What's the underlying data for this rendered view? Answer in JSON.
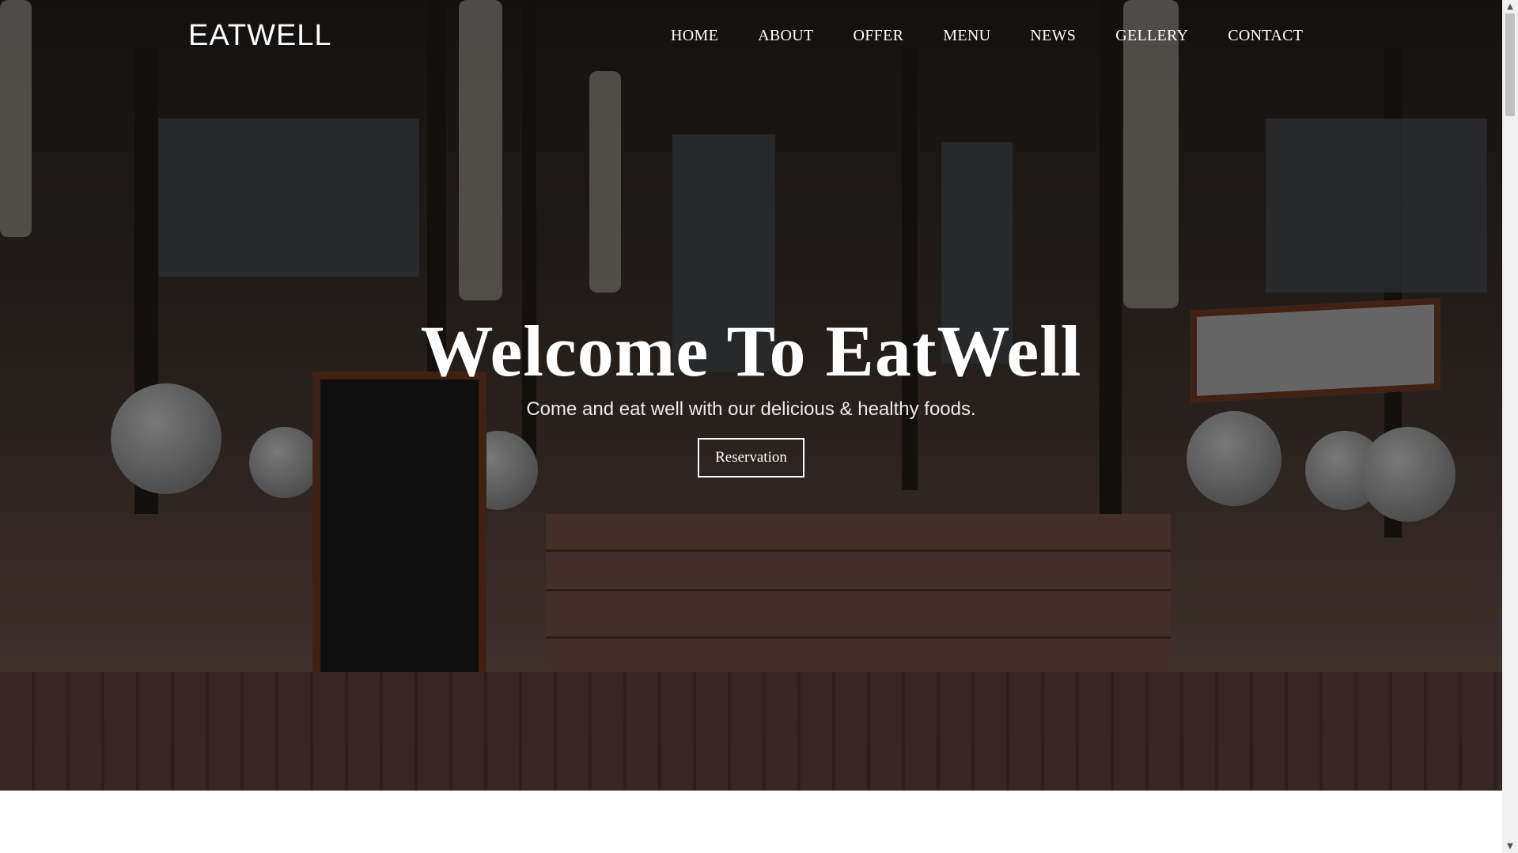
{
  "brand": {
    "logo": "EATWELL"
  },
  "nav": {
    "items": [
      "HOME",
      "ABOUT",
      "OFFER",
      "MENU",
      "NEWS",
      "GELLERY",
      "CONTACT"
    ]
  },
  "hero": {
    "title": "Welcome To EatWell",
    "subtitle": "Come and eat well with our delicious & healthy foods.",
    "cta": "Reservation"
  },
  "scrollbar": {
    "up_icon": "▲",
    "down_icon": "▼"
  }
}
